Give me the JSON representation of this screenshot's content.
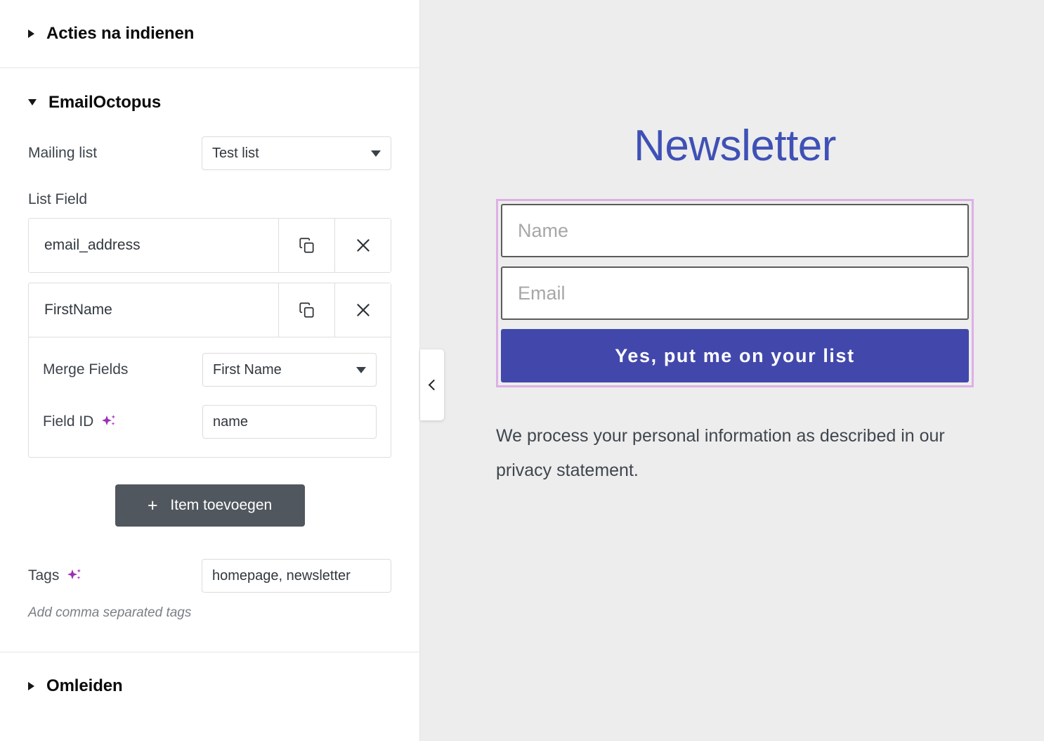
{
  "sidebar": {
    "sections": [
      {
        "id": "acties-na-indienen",
        "title": "Acties na indienen",
        "expanded": false,
        "triangle": "triangle-right-icon"
      },
      {
        "id": "emailoctopus",
        "title": "EmailOctopus",
        "expanded": true,
        "triangle": "triangle-down-icon"
      },
      {
        "id": "omleiden",
        "title": "Omleiden",
        "expanded": false,
        "triangle": "triangle-right-icon"
      }
    ],
    "emailoctopus": {
      "mailing_list": {
        "label": "Mailing list",
        "value": "Test list",
        "icon": "chevron-down-icon"
      },
      "list_field": {
        "label": "List Field",
        "items": [
          {
            "name": "email_address",
            "copy_icon": "copy-icon",
            "remove_icon": "close-icon",
            "expanded": false
          },
          {
            "name": "FirstName",
            "copy_icon": "copy-icon",
            "remove_icon": "close-icon",
            "expanded": true,
            "merge_fields": {
              "label": "Merge Fields",
              "value": "First Name",
              "icon": "chevron-down-icon"
            },
            "field_id": {
              "label": "Field ID",
              "value": "name",
              "icon": "sparkle-icon"
            }
          }
        ],
        "add_button": {
          "label": "Item toevoegen",
          "icon": "plus-icon"
        }
      },
      "tags": {
        "label": "Tags",
        "icon": "sparkle-icon",
        "value": "homepage, newsletter",
        "helper": "Add comma separated tags"
      }
    },
    "collapse_handle": {
      "icon": "chevron-left-icon"
    }
  },
  "preview": {
    "title": "Newsletter",
    "fields": [
      {
        "name": "name",
        "placeholder": "Name",
        "value": ""
      },
      {
        "name": "email",
        "placeholder": "Email",
        "value": ""
      }
    ],
    "submit_label": "Yes, put me on your list",
    "privacy_text": "We process your personal information as described in our privacy statement."
  },
  "colors": {
    "accent_blue": "#3f51b5",
    "button_blue": "#4248ab",
    "selection_purple": "#ddb0e6",
    "sparkle_purple": "#a02ab8",
    "dark_button": "#50575e",
    "canvas_bg": "#ededed"
  }
}
